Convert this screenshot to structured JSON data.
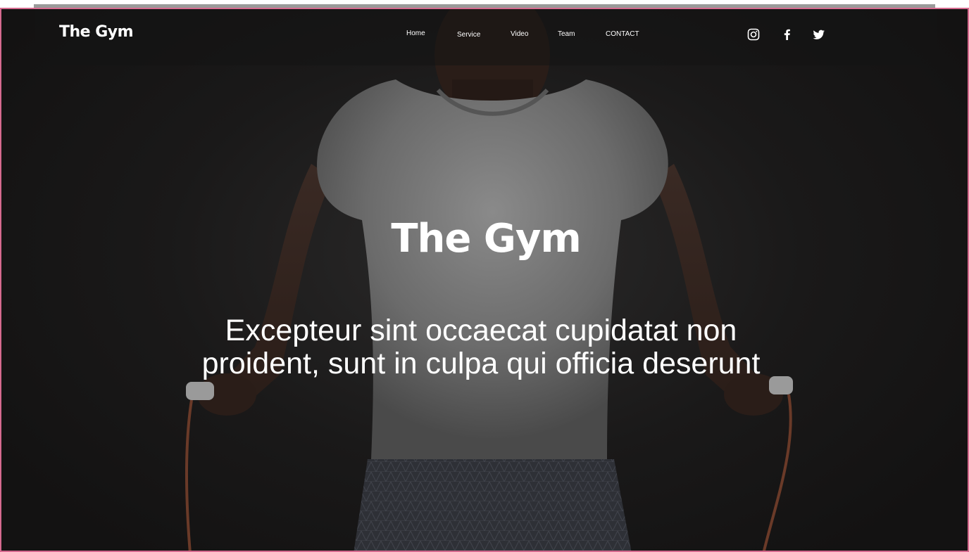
{
  "brand": {
    "logo_text": "The Gym"
  },
  "nav": {
    "links": [
      "Home",
      "Service",
      "Video",
      "Team",
      "CONTACT"
    ]
  },
  "social": {
    "icons": [
      "instagram-icon",
      "facebook-icon",
      "twitter-icon"
    ]
  },
  "hero": {
    "title": "The Gym",
    "subtitle": "Excepteur sint occaecat cupidatat non proident, sunt in culpa qui officia deserunt"
  },
  "colors": {
    "frame_border": "#d66a8f",
    "background": "#1a1919",
    "text": "#ffffff"
  }
}
